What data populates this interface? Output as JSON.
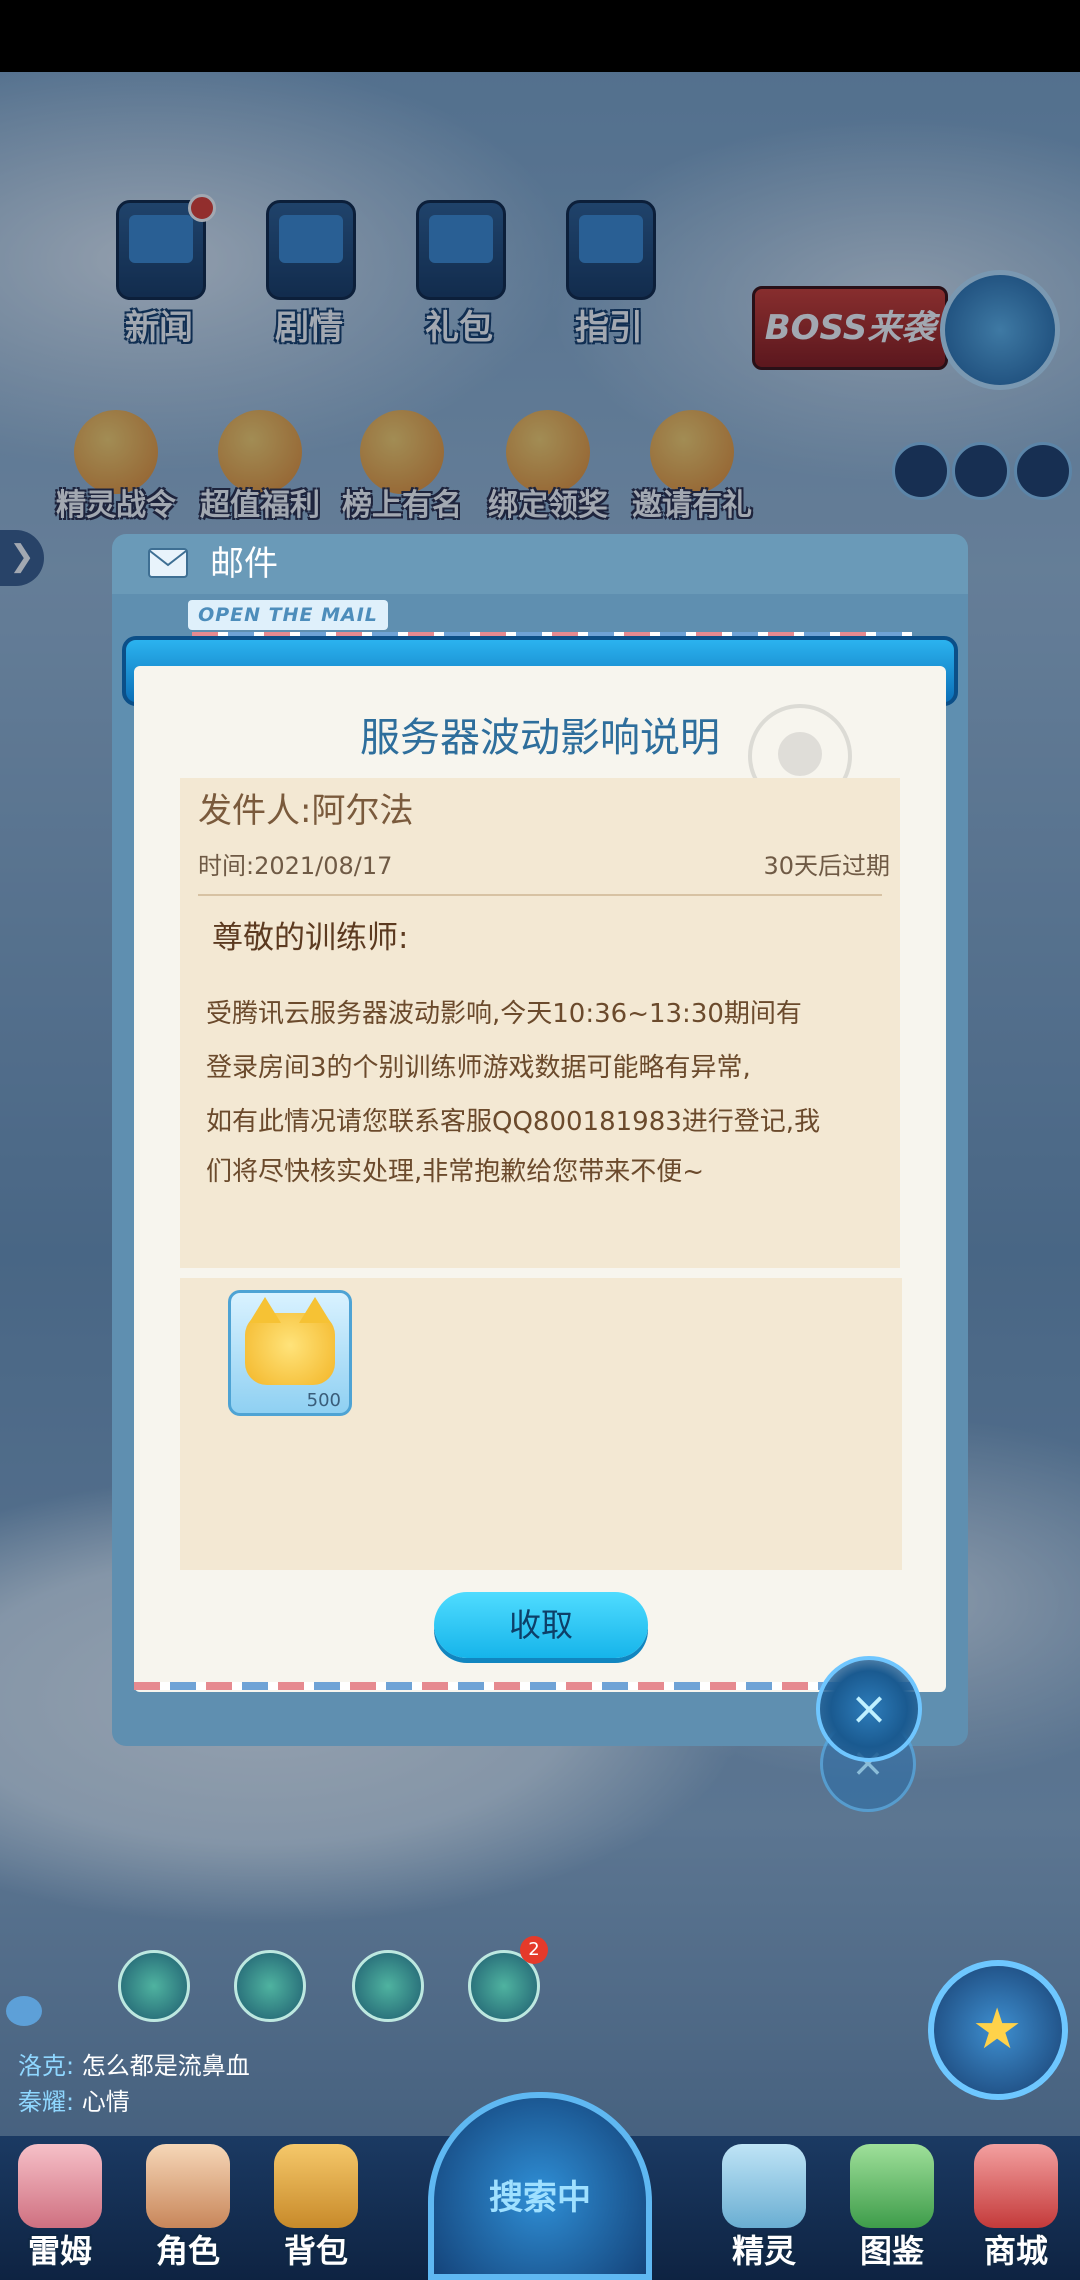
{
  "top_icons": [
    {
      "label": "新闻"
    },
    {
      "label": "剧情"
    },
    {
      "label": "礼包"
    },
    {
      "label": "指引"
    }
  ],
  "mid_icons": [
    {
      "label": "精灵战令"
    },
    {
      "label": "超值福利"
    },
    {
      "label": "榜上有名"
    },
    {
      "label": "绑定领奖"
    },
    {
      "label": "邀请有礼"
    }
  ],
  "boss_banner": "BOSS来袭",
  "mail": {
    "header_title": "邮件",
    "open_tag": "OPEN THE MAIL",
    "title": "服务器波动影响说明",
    "sender": "发件人:阿尔法",
    "date": "时间:2021/08/17",
    "expiry": "30天后过期",
    "greeting": "尊敬的训练师:",
    "body_lines": [
      "受腾讯云服务器波动影响,今天10:36~13:30期间有",
      "登录房间3的个别训练师游戏数据可能略有异常,",
      "如有此情况请您联系客服QQ800181983进行登记,我",
      "们将尽快核实处理,非常抱歉给您带来不便~"
    ],
    "reward_count": "500",
    "claim_label": "收取",
    "close_symbol": "×"
  },
  "side_arrow": "❯",
  "badge_count": "2",
  "chat": [
    {
      "name": "洛克:",
      "message": "怎么都是流鼻血"
    },
    {
      "name": "秦耀:",
      "message": "心情"
    }
  ],
  "nav": [
    {
      "label": "雷姆"
    },
    {
      "label": "角色"
    },
    {
      "label": "背包"
    },
    {
      "label": "精灵"
    },
    {
      "label": "图鉴"
    },
    {
      "label": "商城"
    }
  ],
  "search_label": "搜索中",
  "colors": {
    "accent": "#16b4ea",
    "title": "#2e6e9c",
    "paper": "#f3e8d3",
    "badge": "#e53a2a"
  }
}
